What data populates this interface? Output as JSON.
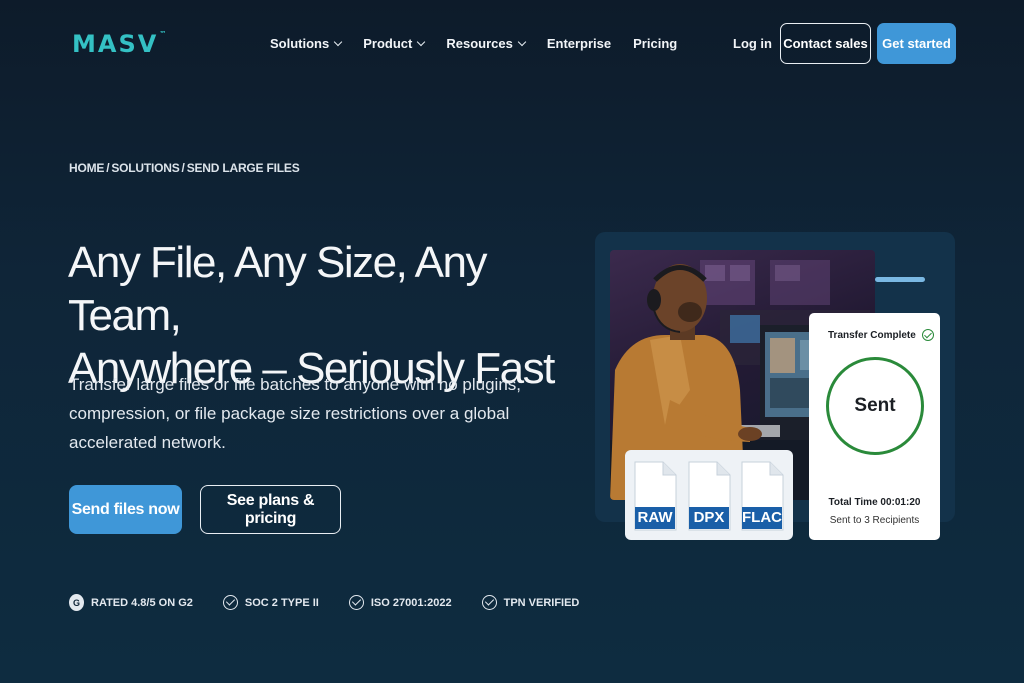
{
  "nav": {
    "logo": "MASV",
    "logo_tm": "™",
    "items": [
      {
        "label": "Solutions",
        "has_dropdown": true
      },
      {
        "label": "Product",
        "has_dropdown": true
      },
      {
        "label": "Resources",
        "has_dropdown": true
      },
      {
        "label": "Enterprise",
        "has_dropdown": false
      },
      {
        "label": "Pricing",
        "has_dropdown": false
      }
    ],
    "login": "Log in",
    "contact": "Contact sales",
    "get_started": "Get started"
  },
  "breadcrumb": {
    "home": "HOME",
    "solutions": "SOLUTIONS",
    "current": "SEND LARGE FILES",
    "separator": "/"
  },
  "hero": {
    "headline_line1": "Any File, Any Size, Any Team,",
    "headline_line2": "Anywhere – Seriously Fast",
    "subtext": "Transfer large files or file batches to anyone with no plugins, compression, or file package size restrictions over a global accelerated network.",
    "primary_cta": "Send files now",
    "secondary_cta": "See plans & pricing"
  },
  "badges": [
    {
      "icon": "g2-icon",
      "label": "RATED 4.8/5 ON G2"
    },
    {
      "icon": "check-circle-icon",
      "label": "SOC 2 TYPE II"
    },
    {
      "icon": "check-circle-icon",
      "label": "ISO 27001:2022"
    },
    {
      "icon": "check-circle-icon",
      "label": "TPN VERIFIED"
    }
  ],
  "files": [
    "RAW",
    "DPX",
    "FLAC"
  ],
  "transfer": {
    "title": "Transfer Complete",
    "status": "Sent",
    "total_time": "Total Time 00:01:20",
    "recipients": "Sent to 3 Recipients"
  },
  "colors": {
    "accent": "#3f97d8",
    "logo": "#34c1c4",
    "success": "#2a8a3a",
    "file_label": "#1a5fa8"
  }
}
